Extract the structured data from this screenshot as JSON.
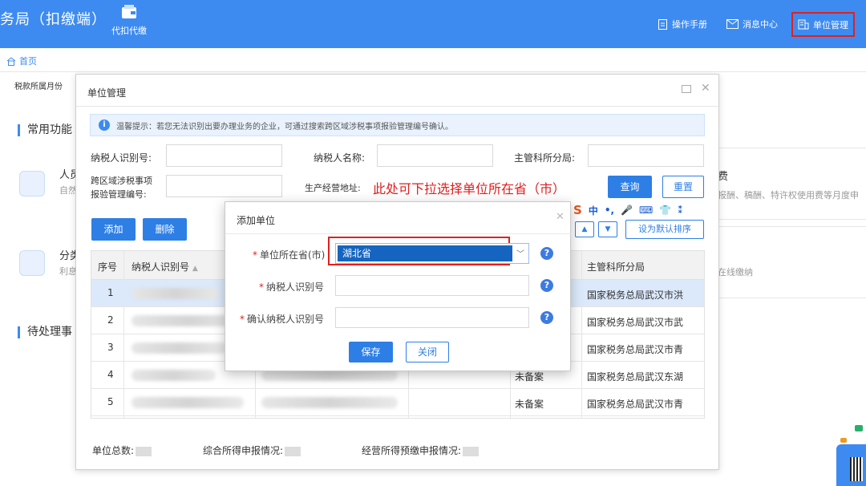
{
  "topbar": {
    "app_title": "务局（扣缴端）",
    "nav_proxy_label": "代扣代缴",
    "manual_label": "操作手册",
    "messages_label": "消息中心",
    "unit_mgmt_label": "单位管理",
    "bg_color": "#3d8bf0"
  },
  "crumb": {
    "home_label": "首页"
  },
  "page": {
    "tax_month_label": "税款所属月份",
    "common_functions": "常用功能",
    "pending_items": "待处理事",
    "card1_title": "人员",
    "card1_sub": "自然",
    "card2_title": "分类",
    "card2_sub": "利息",
    "right_card1_title": "费",
    "right_card1_sub": "报酬、稿酬、特许权使用费等月度申",
    "right_card2_sub": "在线缴纳"
  },
  "unit_dialog": {
    "title": "单位管理",
    "tip": "温馨提示：若您无法识别出要办理业务的企业，可通过搜索跨区域涉税事项报验管理编号确认。",
    "labels": {
      "taxpayer_id": "纳税人识别号:",
      "taxpayer_name": "纳税人名称:",
      "tax_office": "主管科所分局:",
      "cross_region_1": "跨区域涉税事项",
      "cross_region_2": "报验管理编号:",
      "business_address": "生产经营地址:"
    },
    "buttons": {
      "query": "查询",
      "reset": "重置",
      "add": "添加",
      "delete": "删除",
      "set_default": "设为默认排序",
      "up": "▲",
      "down": "▼"
    },
    "annotation": "此处可下拉选择单位所在省（市）",
    "ime_toolbar": [
      "中",
      "•,",
      "🎤",
      "⌨",
      "👕",
      "⁑"
    ],
    "table": {
      "headers": [
        "序号",
        "纳税人识别号",
        "主管科所分局"
      ],
      "rows": [
        {
          "no": "1",
          "status": "",
          "org": "国家税务总局武汉市洪"
        },
        {
          "no": "2",
          "status": "",
          "org": "国家税务总局武汉市武"
        },
        {
          "no": "3",
          "status": "",
          "org": "国家税务总局武汉市青"
        },
        {
          "no": "4",
          "status": "未备案",
          "org": "国家税务总局武汉东湖"
        },
        {
          "no": "5",
          "status": "未备案",
          "org": "国家税务总局武汉市青"
        }
      ]
    },
    "footer": {
      "unit_total": "单位总数:",
      "comprehensive": "综合所得申报情况:",
      "business": "经营所得预缴申报情况:"
    }
  },
  "add_dialog": {
    "title": "添加单位",
    "province_label": "单位所在省(市)",
    "province_value": "湖北省",
    "taxpayer_id_label": "纳税人识别号",
    "confirm_id_label": "确认纳税人识别号",
    "save": "保存",
    "close": "关闭",
    "help": "?"
  }
}
